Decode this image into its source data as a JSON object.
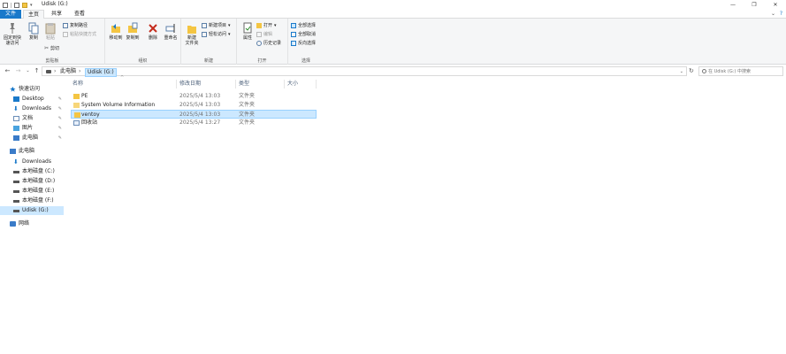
{
  "titlebar": {
    "title": "Udisk (G:)",
    "minimize": "—",
    "maximize": "❐",
    "close": "✕"
  },
  "tabs": {
    "file": "文件",
    "home": "主页",
    "share": "共享",
    "view": "查看"
  },
  "ribbon": {
    "clipboard": {
      "label": "剪贴板",
      "pin": "固定到快速访问",
      "copy": "复制",
      "paste": "粘贴",
      "copy_path": "复制路径",
      "paste_shortcut": "粘贴快捷方式",
      "cut": "剪切"
    },
    "organize": {
      "label": "组织",
      "move_to": "移动到",
      "copy_to": "复制到",
      "delete": "删除",
      "rename": "重命名"
    },
    "new": {
      "label": "新建",
      "new_folder": "新建\n文件夹",
      "new_item": "新建项目",
      "easy_access": "轻松访问"
    },
    "open": {
      "label": "打开",
      "properties": "属性",
      "open": "打开",
      "edit": "编辑",
      "history": "历史记录"
    },
    "select": {
      "label": "选择",
      "select_all": "全部选择",
      "select_none": "全部取消",
      "invert": "反向选择"
    }
  },
  "address": {
    "crumbs": [
      "此电脑",
      "Udisk (G:)"
    ],
    "search_placeholder": "在 Udisk (G:) 中搜索"
  },
  "nav": {
    "quick_access": "快速访问",
    "items": [
      {
        "label": "Desktop",
        "pinned": true
      },
      {
        "label": "Downloads",
        "pinned": true
      },
      {
        "label": "文档",
        "pinned": true
      },
      {
        "label": "图片",
        "pinned": true
      },
      {
        "label": "此电脑",
        "pinned": true
      }
    ],
    "this_pc": "此电脑",
    "pc_items": [
      {
        "label": "Downloads"
      },
      {
        "label": "本地磁盘 (C:)"
      },
      {
        "label": "本地磁盘 (D:)"
      },
      {
        "label": "本地磁盘 (E:)"
      },
      {
        "label": "本地磁盘 (F:)"
      },
      {
        "label": "Udisk (G:)"
      }
    ],
    "network": "网络"
  },
  "list": {
    "columns": [
      "名称",
      "修改日期",
      "类型",
      "大小"
    ],
    "rows": [
      {
        "name": "PE",
        "date": "2025/5/4 13:03",
        "type": "文件夹",
        "size": ""
      },
      {
        "name": "System Volume Information",
        "date": "2025/5/4 13:03",
        "type": "文件夹",
        "size": ""
      },
      {
        "name": "ventoy",
        "date": "2025/5/4 13:03",
        "type": "文件夹",
        "size": ""
      },
      {
        "name": "回收站",
        "date": "2025/5/4 13:27",
        "type": "文件夹",
        "size": ""
      }
    ]
  },
  "colors": {
    "accent": "#1979ca",
    "selection": "#cce8ff",
    "folder": "#f4c542"
  }
}
